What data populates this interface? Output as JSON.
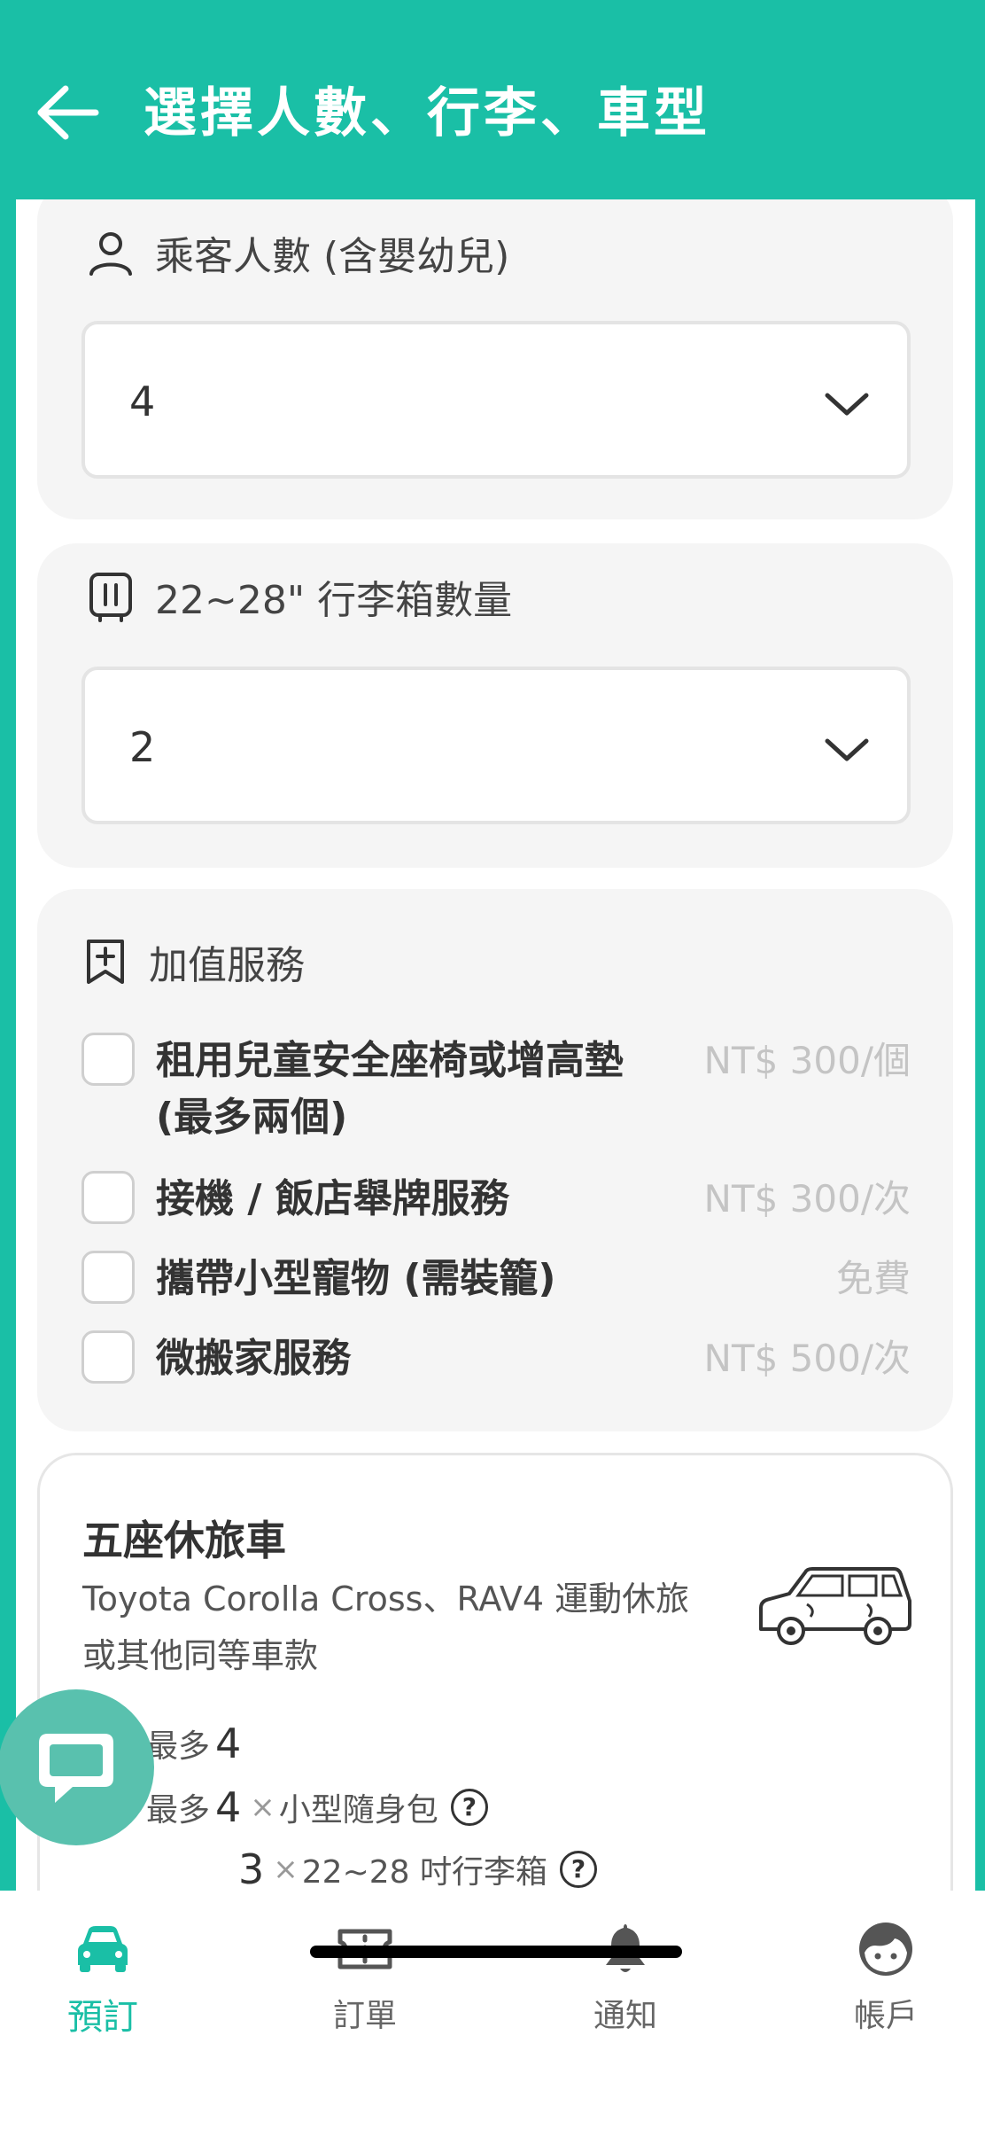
{
  "header": {
    "title": "選擇人數、行李、車型"
  },
  "passengers": {
    "label": "乘客人數 (含嬰幼兒)",
    "value": "4"
  },
  "luggage": {
    "label": "22~28\" 行李箱數量",
    "value": "2"
  },
  "services": {
    "label": "加值服務",
    "items": [
      {
        "name": "租用兒童安全座椅或增高墊 (最多兩個)",
        "price": "NT$ 300/個",
        "checked": false
      },
      {
        "name": "接機 / 飯店舉牌服務",
        "price": "NT$ 300/次",
        "checked": false
      },
      {
        "name": "攜帶小型寵物 (需裝籠)",
        "price": "免費",
        "checked": false
      },
      {
        "name": "微搬家服務",
        "price": "NT$ 500/次",
        "checked": false
      }
    ]
  },
  "vehicle": {
    "name": "五座休旅車",
    "description": "Toyota Corolla Cross、RAV4 運動休旅或其他同等車款",
    "max_label": "最多",
    "max_passengers": "4",
    "bag_count": "4",
    "bag_label": "小型隨身包",
    "suitcase_count": "3",
    "suitcase_label": "22~28 吋行李箱",
    "times": "×",
    "help": "?"
  },
  "tabs": [
    {
      "label": "預訂",
      "icon": "car-icon",
      "active": true
    },
    {
      "label": "訂單",
      "icon": "ticket-icon",
      "active": false
    },
    {
      "label": "通知",
      "icon": "bell-icon",
      "active": false
    },
    {
      "label": "帳戶",
      "icon": "face-icon",
      "active": false
    }
  ],
  "colors": {
    "brand": "#1ABFA6",
    "card_bg": "#F5F5F5",
    "price": "#C4C4C4"
  }
}
